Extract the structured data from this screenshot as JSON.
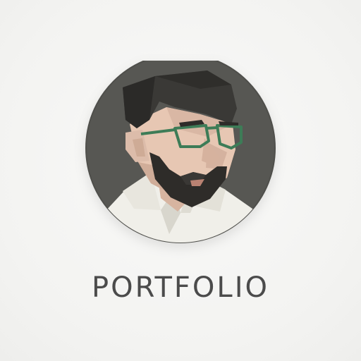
{
  "logo": {
    "title": "PORTFOLIO",
    "avatar_icon": "man-with-glasses-portrait-icon"
  },
  "colors": {
    "background": "#f4f4f2",
    "circle": "#575753",
    "hair": "#3a3936",
    "skin": "#e7c7b3",
    "beard": "#2e2c29",
    "glasses": "#3d7c57",
    "shirt": "#f0efe9",
    "title": "#4b4b4b"
  }
}
